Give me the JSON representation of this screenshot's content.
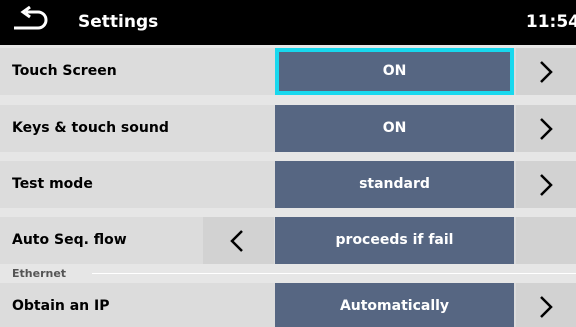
{
  "header": {
    "title": "Settings",
    "time": "11:54",
    "back_icon": "back-arrow-icon"
  },
  "rows": [
    {
      "label": "Touch Screen",
      "value": "ON",
      "selected": true,
      "right_arrow": true,
      "left_arrow": false
    },
    {
      "label": "Keys & touch sound",
      "value": "ON",
      "selected": false,
      "right_arrow": true,
      "left_arrow": false
    },
    {
      "label": "Test mode",
      "value": "standard",
      "selected": false,
      "right_arrow": true,
      "left_arrow": false
    },
    {
      "label": "Auto Seq. flow",
      "value": "proceeds if fail",
      "selected": false,
      "right_arrow": false,
      "left_arrow": true
    }
  ],
  "section": {
    "label": "Ethernet"
  },
  "ethernet_rows": [
    {
      "label": "Obtain an IP",
      "value": "Automatically",
      "selected": false,
      "right_arrow": true,
      "left_arrow": false
    }
  ],
  "colors": {
    "header_bg": "#000000",
    "value_bg": "#566682",
    "selection_border": "#18d8ee",
    "row_bg": "#dcdcdc"
  }
}
